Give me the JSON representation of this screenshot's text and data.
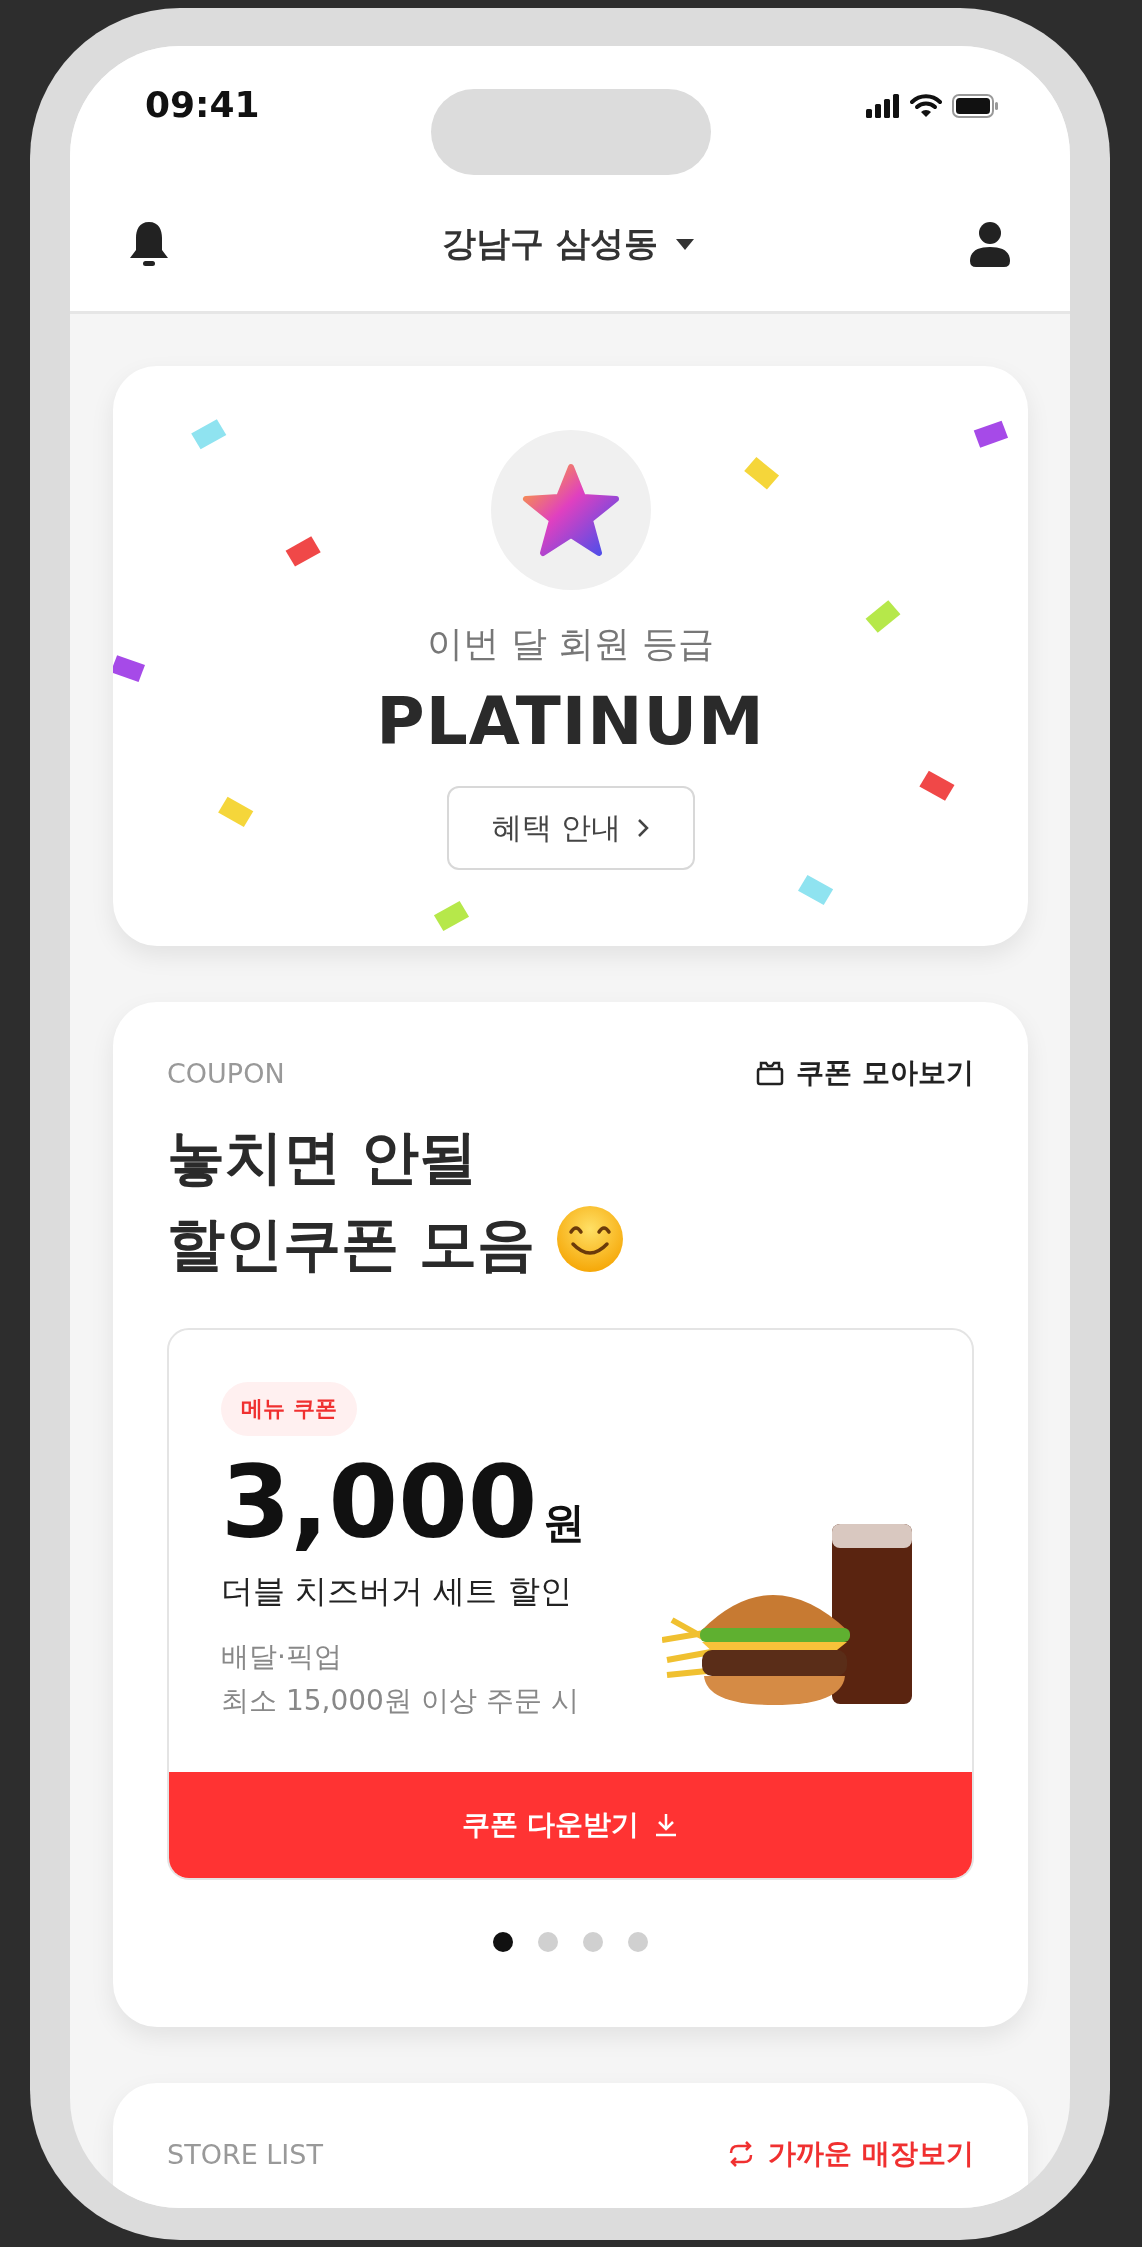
{
  "status_bar": {
    "time": "09:41"
  },
  "header": {
    "location": "강남구 삼성동"
  },
  "membership": {
    "caption": "이번 달 회원 등급",
    "grade": "PLATINUM",
    "benefits_button": "혜택 안내"
  },
  "coupon_section": {
    "eyebrow": "COUPON",
    "link": "쿠폰 모아보기",
    "title_lines": [
      "놓치면 안될",
      "할인쿠폰 모음"
    ],
    "coupon": {
      "tag": "메뉴 쿠폰",
      "amount": "3,000",
      "unit": "원",
      "name": "더블 치즈버거 세트 할인",
      "channels": "배달·픽업",
      "condition": "최소 15,000원 이상 주문 시",
      "download_button": "쿠폰 다운받기"
    },
    "pages": [
      {
        "selected": true
      },
      {
        "selected": false
      },
      {
        "selected": false
      },
      {
        "selected": false
      }
    ]
  },
  "store_section": {
    "eyebrow": "STORE LIST",
    "link": "가까운 매장보기"
  }
}
